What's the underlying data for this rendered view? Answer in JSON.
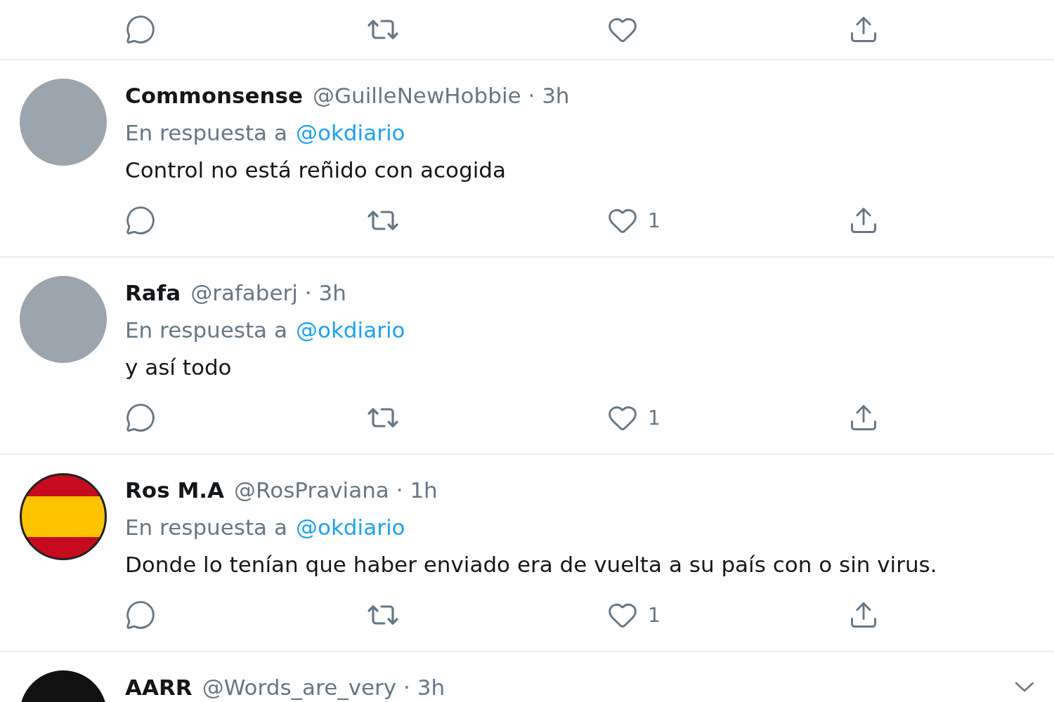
{
  "tweets": [
    {
      "avatar": {
        "kind": "photo"
      },
      "name": "Commonsense",
      "handle": "@GuilleNewHobbie",
      "separator": "·",
      "time": "3h",
      "reply_prefix": "En respuesta a",
      "reply_to": "@okdiario",
      "text": "Control no está reñido con acogida",
      "likes": "1"
    },
    {
      "avatar": {
        "kind": "photo"
      },
      "name": "Rafa",
      "handle": "@rafaberj",
      "separator": "·",
      "time": "3h",
      "reply_prefix": "En respuesta a",
      "reply_to": "@okdiario",
      "text": "y así todo",
      "likes": "1"
    },
    {
      "avatar": {
        "kind": "flag"
      },
      "name": "Ros M.A",
      "handle": "@RosPraviana",
      "separator": "·",
      "time": "1h",
      "reply_prefix": "En respuesta a",
      "reply_to": "@okdiario",
      "text": "Donde lo tenían que haber enviado era de vuelta a su país con o sin virus.",
      "likes": "1"
    },
    {
      "avatar": {
        "kind": "dark"
      },
      "name": "AARR",
      "handle": "@Words_are_very",
      "separator": "·",
      "time": "3h"
    }
  ]
}
